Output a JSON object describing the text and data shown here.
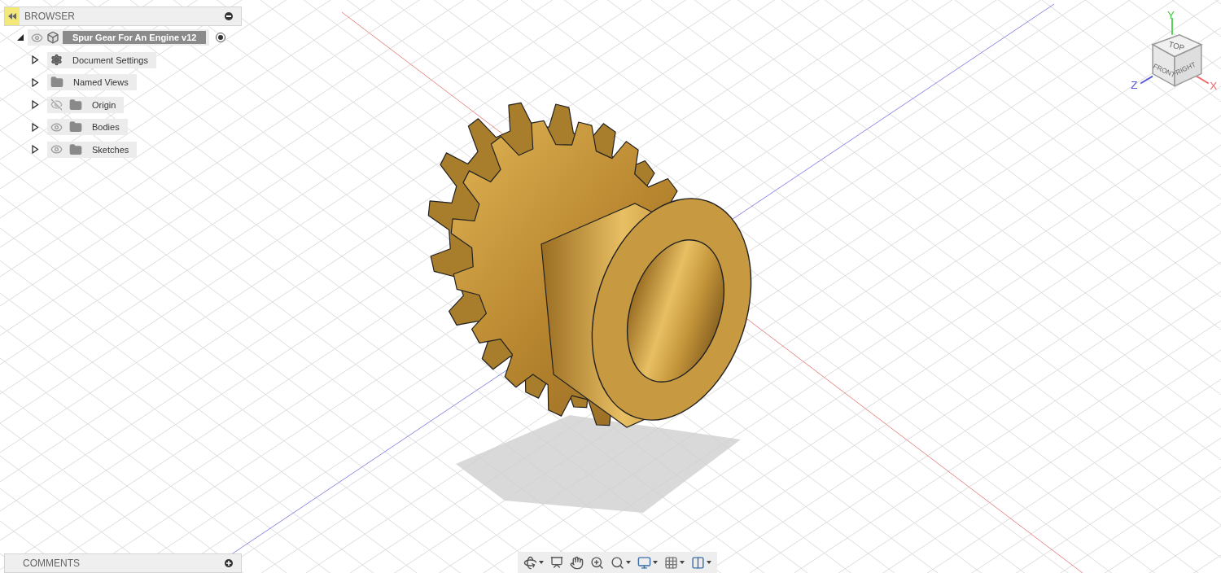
{
  "browser": {
    "title": "BROWSER",
    "root": {
      "label": "Spur Gear For An Engine v12",
      "expanded": true,
      "visible": true,
      "active": true
    },
    "items": [
      {
        "label": "Document Settings",
        "kind": "settings",
        "expanded": false
      },
      {
        "label": "Named Views",
        "kind": "folder",
        "expanded": false
      },
      {
        "label": "Origin",
        "kind": "folder",
        "expanded": false,
        "visible": false
      },
      {
        "label": "Bodies",
        "kind": "folder",
        "expanded": false,
        "visible": true
      },
      {
        "label": "Sketches",
        "kind": "folder",
        "expanded": false,
        "visible": true
      }
    ]
  },
  "viewcube": {
    "faces": {
      "top": "TOP",
      "front": "FRONT",
      "right": "RIGHT"
    },
    "axes": {
      "y": "Y",
      "z": "Z",
      "x": "X"
    }
  },
  "comments": {
    "title": "COMMENTS"
  },
  "toolbar": {
    "tools": [
      {
        "kind": "orbit",
        "dropdown": true
      },
      {
        "kind": "look",
        "dropdown": false
      },
      {
        "kind": "pan",
        "dropdown": false
      },
      {
        "kind": "zoom",
        "dropdown": false
      },
      {
        "kind": "fit",
        "dropdown": true
      },
      {
        "kind": "display",
        "dropdown": true
      },
      {
        "kind": "grid",
        "dropdown": true
      },
      {
        "kind": "viewports",
        "dropdown": true
      }
    ]
  }
}
